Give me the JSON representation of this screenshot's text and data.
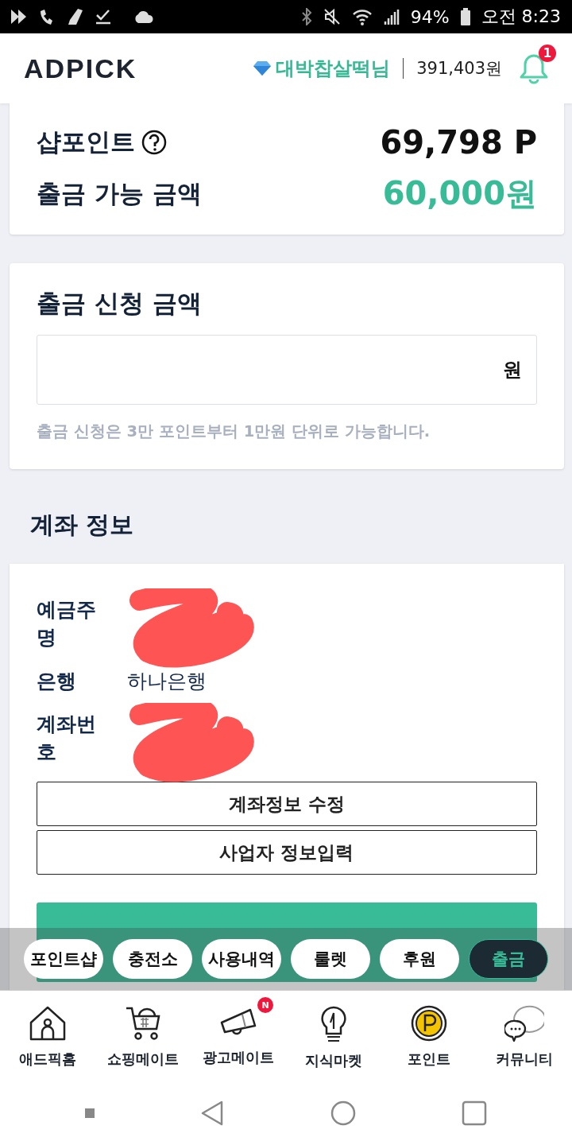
{
  "status_bar": {
    "battery": "94%",
    "time": "오전 8:23"
  },
  "header": {
    "logo": "ADPICK",
    "username": "대박찹살떡님",
    "balance": "391,403원",
    "notification_count": "1"
  },
  "summary": [
    {
      "label": "샵포인트",
      "value": "69,798 P",
      "kind": "points"
    },
    {
      "label": "출금 가능 금액",
      "value": "60,000원",
      "kind": "cash"
    }
  ],
  "withdraw_form": {
    "title": "출금 신청 금액",
    "unit": "원",
    "hint": "출금 신청은 3만 포인트부터 1만원 단위로 가능합니다."
  },
  "account": {
    "title": "계좌 정보",
    "fields": [
      {
        "label": "예금주명",
        "redacted": true
      },
      {
        "label": "은행",
        "value": "하나은행",
        "redacted": false
      },
      {
        "label": "계좌번호",
        "redacted": true
      }
    ],
    "buttons": [
      "계좌정보 수정",
      "사업자 정보입력"
    ]
  },
  "chips": [
    {
      "label": "포인트샵",
      "selected": false
    },
    {
      "label": "충전소",
      "selected": false
    },
    {
      "label": "사용내역",
      "selected": false
    },
    {
      "label": "룰렛",
      "selected": false
    },
    {
      "label": "후원",
      "selected": false
    },
    {
      "label": "출금",
      "selected": true
    }
  ],
  "bottom_nav": [
    {
      "label": "애드픽홈",
      "kind": "home"
    },
    {
      "label": "쇼핑메이트",
      "kind": "cart"
    },
    {
      "label": "광고메이트",
      "kind": "megaphone",
      "badge": "N"
    },
    {
      "label": "지식마켓",
      "kind": "bulb"
    },
    {
      "label": "포인트",
      "kind": "point"
    },
    {
      "label": "커뮤니티",
      "kind": "chat"
    }
  ]
}
